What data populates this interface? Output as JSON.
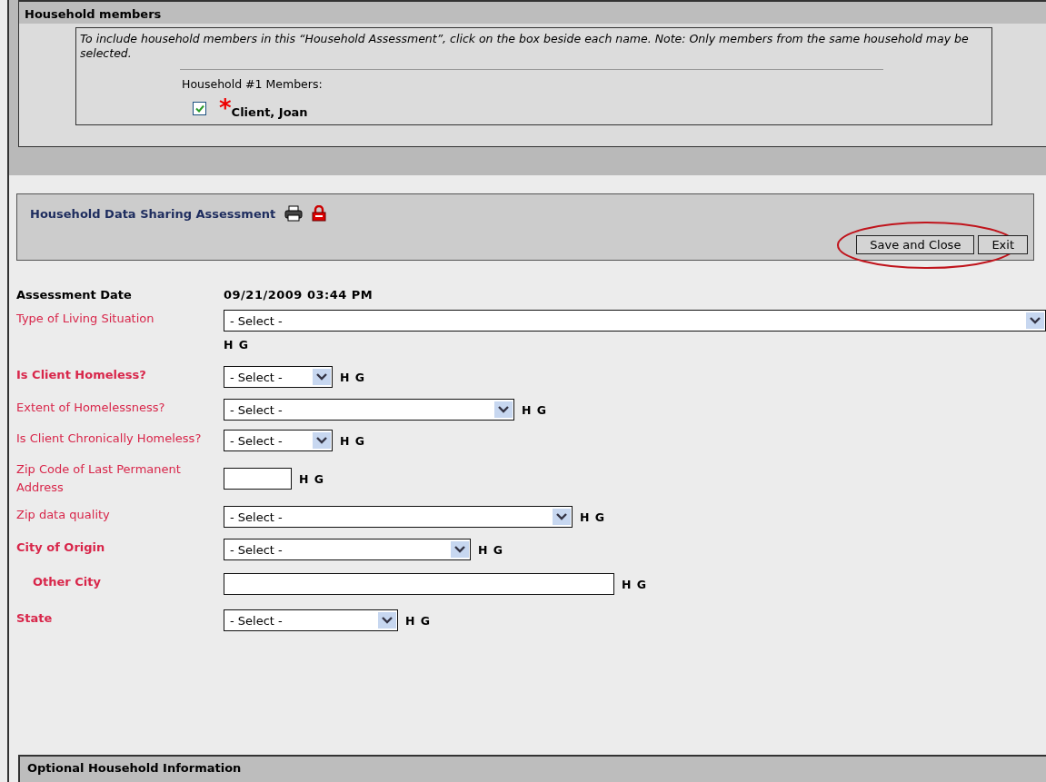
{
  "household_members": {
    "title": "Household members",
    "instructions": "To include household members in this “Household Assessment”, click on the box beside each name. Note: Only members from the same household may be selected.",
    "group_label": "Household #1 Members:",
    "members": [
      {
        "name": "Client, Joan",
        "checked": true,
        "required_mark": "*"
      }
    ]
  },
  "assessment": {
    "title": "Household Data Sharing Assessment",
    "buttons": [
      {
        "label": "Save and Close",
        "highlighted": true
      },
      {
        "label": "Exit",
        "highlighted": false
      }
    ],
    "date_label": "Assessment Date",
    "date_value": "09/21/2009 03:44 PM",
    "fields": [
      {
        "label": "Type of Living Situation",
        "kind": "select",
        "value": "- Select -",
        "bold": false,
        "indented": false,
        "flags": "H G"
      },
      {
        "label": "Is Client Homeless?",
        "kind": "select",
        "value": "- Select -",
        "bold": true,
        "indented": false,
        "flags": "H G"
      },
      {
        "label": "Extent of Homelessness?",
        "kind": "select",
        "value": "- Select -",
        "bold": false,
        "indented": false,
        "flags": "H G"
      },
      {
        "label": "Is Client Chronically Homeless?",
        "kind": "select",
        "value": "- Select -",
        "bold": false,
        "indented": false,
        "flags": "H G"
      },
      {
        "label": "Zip Code of Last Permanent Address",
        "kind": "text",
        "bold": false,
        "indented": false,
        "flags": "H G"
      },
      {
        "label": "Zip data quality",
        "kind": "select",
        "value": "- Select -",
        "bold": false,
        "indented": false,
        "flags": "H G"
      },
      {
        "label": "City of Origin",
        "kind": "select",
        "value": "- Select -",
        "bold": true,
        "indented": false,
        "flags": "H G"
      },
      {
        "label": "Other City",
        "kind": "text",
        "bold": true,
        "indented": true,
        "flags": "H G"
      },
      {
        "label": "State",
        "kind": "select",
        "value": "- Select -",
        "bold": true,
        "indented": false,
        "flags": "H G"
      }
    ]
  },
  "optional_section": {
    "title": "Optional Household Information"
  }
}
